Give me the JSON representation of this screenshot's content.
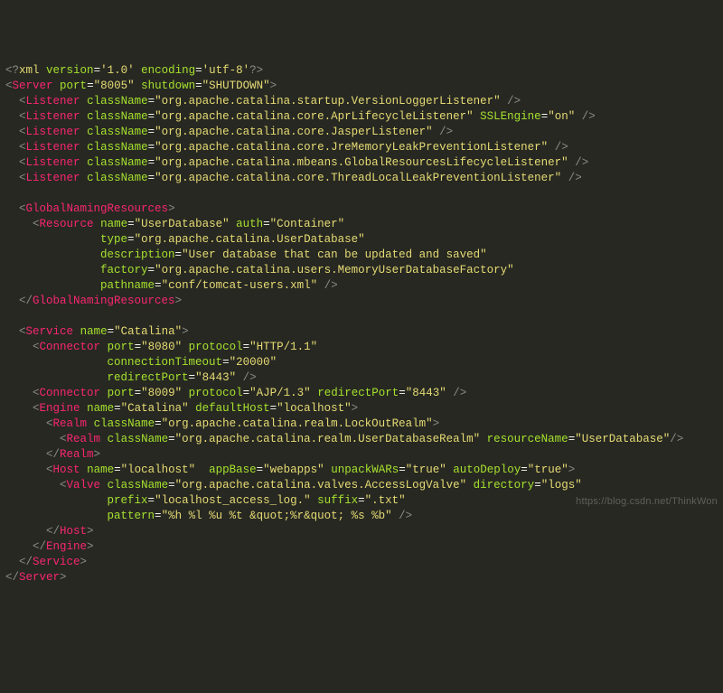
{
  "xml_decl": {
    "version": "'1.0'",
    "encoding": "'utf-8'"
  },
  "server": {
    "port": "\"8005\"",
    "shutdown": "\"SHUTDOWN\""
  },
  "listeners": [
    {
      "className": "\"org.apache.catalina.startup.VersionLoggerListener\""
    },
    {
      "className": "\"org.apache.catalina.core.AprLifecycleListener\"",
      "SSLEngine": "\"on\""
    },
    {
      "className": "\"org.apache.catalina.core.JasperListener\""
    },
    {
      "className": "\"org.apache.catalina.core.JreMemoryLeakPreventionListener\""
    },
    {
      "className": "\"org.apache.catalina.mbeans.GlobalResourcesLifecycleListener\""
    },
    {
      "className": "\"org.apache.catalina.core.ThreadLocalLeakPreventionListener\""
    }
  ],
  "resource": {
    "name": "\"UserDatabase\"",
    "auth": "\"Container\"",
    "type": "\"org.apache.catalina.UserDatabase\"",
    "description": "\"User database that can be updated and saved\"",
    "factory": "\"org.apache.catalina.users.MemoryUserDatabaseFactory\"",
    "pathname": "\"conf/tomcat-users.xml\""
  },
  "service": {
    "name": "\"Catalina\""
  },
  "connector1": {
    "port": "\"8080\"",
    "protocol": "\"HTTP/1.1\"",
    "connectionTimeout": "\"20000\"",
    "redirectPort": "\"8443\""
  },
  "connector2": {
    "port": "\"8009\"",
    "protocol": "\"AJP/1.3\"",
    "redirectPort": "\"8443\""
  },
  "engine": {
    "name": "\"Catalina\"",
    "defaultHost": "\"localhost\""
  },
  "realm_outer": {
    "className": "\"org.apache.catalina.realm.LockOutRealm\""
  },
  "realm_inner": {
    "className": "\"org.apache.catalina.realm.UserDatabaseRealm\"",
    "resourceName": "\"UserDatabase\""
  },
  "host": {
    "name": "\"localhost\"",
    "appBase": "\"webapps\"",
    "unpackWARs": "\"true\"",
    "autoDeploy": "\"true\""
  },
  "valve": {
    "className": "\"org.apache.catalina.valves.AccessLogValve\"",
    "directory": "\"logs\"",
    "prefix": "\"localhost_access_log.\"",
    "suffix": "\".txt\"",
    "pattern": "\"%h %l %u %t &quot;%r&quot; %s %b\""
  },
  "tags": {
    "xml": "xml",
    "Server": "Server",
    "Listener": "Listener",
    "GlobalNamingResources": "GlobalNamingResources",
    "Resource": "Resource",
    "Service": "Service",
    "Connector": "Connector",
    "Engine": "Engine",
    "Realm": "Realm",
    "Host": "Host",
    "Valve": "Valve"
  },
  "attrs": {
    "version": "version",
    "encoding": "encoding",
    "port": "port",
    "shutdown": "shutdown",
    "className": "className",
    "SSLEngine": "SSLEngine",
    "name": "name",
    "auth": "auth",
    "type": "type",
    "description": "description",
    "factory": "factory",
    "pathname": "pathname",
    "protocol": "protocol",
    "connectionTimeout": "connectionTimeout",
    "redirectPort": "redirectPort",
    "defaultHost": "defaultHost",
    "resourceName": "resourceName",
    "appBase": "appBase",
    "unpackWARs": "unpackWARs",
    "autoDeploy": "autoDeploy",
    "directory": "directory",
    "prefix": "prefix",
    "suffix": "suffix",
    "pattern": "pattern"
  },
  "watermark": "https://blog.csdn.net/ThinkWon"
}
